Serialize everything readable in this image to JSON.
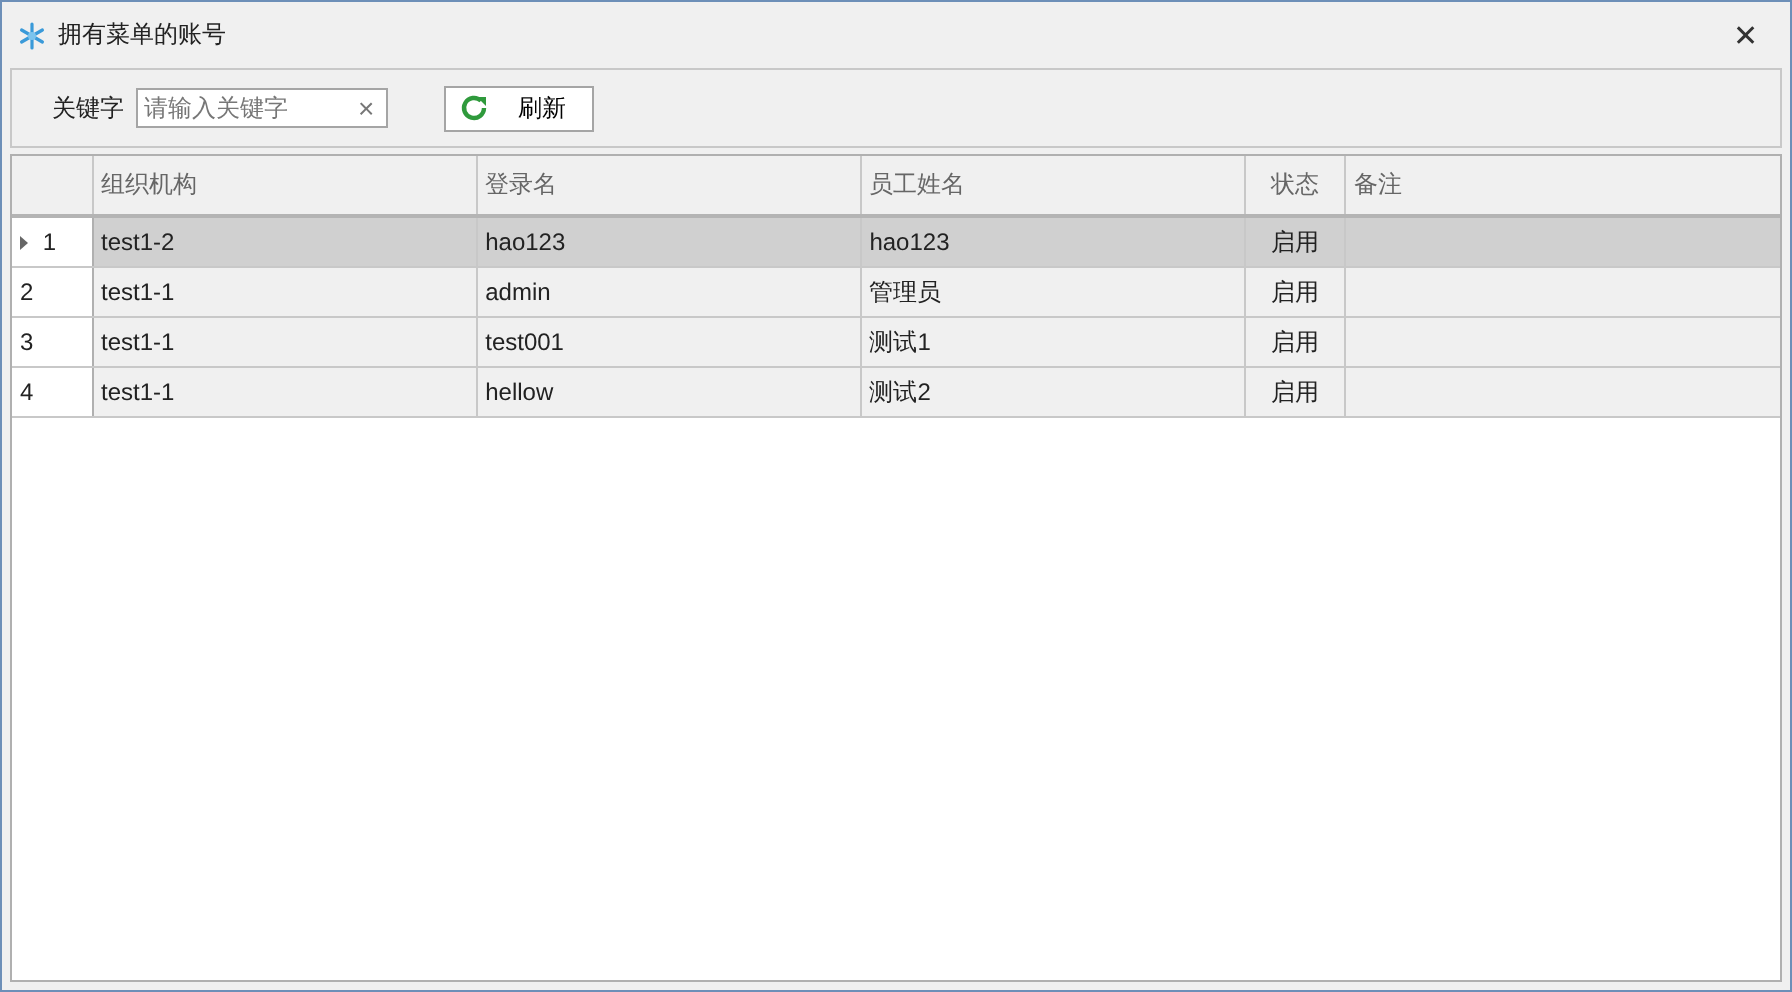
{
  "window": {
    "title": "拥有菜单的账号",
    "close": "✕"
  },
  "toolbar": {
    "label": "关键字",
    "search": {
      "placeholder": "请输入关键字",
      "clear": "×"
    },
    "refresh": "刷新"
  },
  "table": {
    "columns": [
      "组织机构",
      "登录名",
      "员工姓名",
      "状态",
      "备注"
    ],
    "rows": [
      {
        "index": "1",
        "selected": true,
        "cells": [
          "test1-2",
          "hao123",
          "hao123",
          "启用",
          ""
        ]
      },
      {
        "index": "2",
        "selected": false,
        "cells": [
          "test1-1",
          "admin",
          "管理员",
          "启用",
          ""
        ]
      },
      {
        "index": "3",
        "selected": false,
        "cells": [
          "test1-1",
          "test001",
          "测试1",
          "启用",
          ""
        ]
      },
      {
        "index": "4",
        "selected": false,
        "cells": [
          "test1-1",
          "hellow",
          "测试2",
          "启用",
          ""
        ]
      }
    ]
  }
}
